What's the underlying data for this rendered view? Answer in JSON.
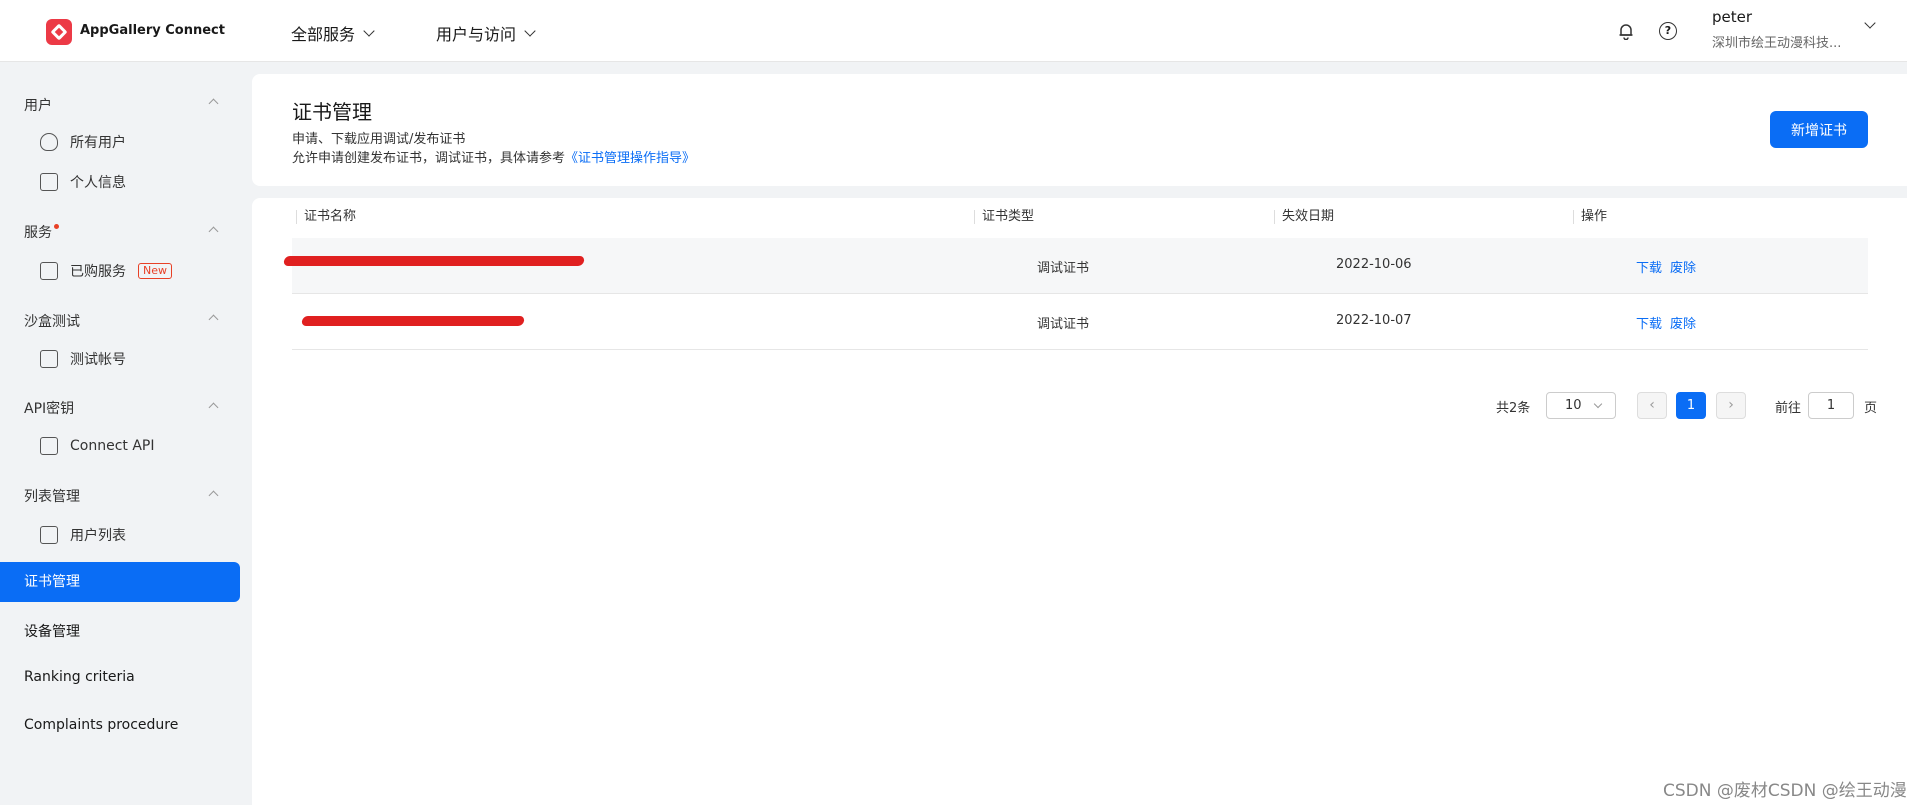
{
  "app": {
    "title": "AppGallery Connect"
  },
  "topnav": {
    "all_services": "全部服务",
    "user_access": "用户与访问"
  },
  "user": {
    "name": "peter",
    "org": "深圳市绘王动漫科技..."
  },
  "sidebar": {
    "section_user": "用户",
    "all_users": "所有用户",
    "profile": "个人信息",
    "section_service": "服务",
    "purchased": "已购服务",
    "new_badge": "New",
    "section_sandbox": "沙盒测试",
    "test_account": "测试帐号",
    "section_api": "API密钥",
    "connect_api": "Connect API",
    "section_list": "列表管理",
    "user_list": "用户列表",
    "cert_mgmt": "证书管理",
    "device_mgmt": "设备管理",
    "ranking": "Ranking criteria",
    "complaints": "Complaints procedure"
  },
  "header": {
    "title": "证书管理",
    "desc1": "申请、下载应用调试/发布证书",
    "desc2_prefix": "允许申请创建发布证书，调试证书，具体请参考",
    "desc2_link": "《证书管理操作指导》",
    "new_button": "新增证书"
  },
  "table": {
    "columns": [
      "证书名称",
      "证书类型",
      "失效日期",
      "操作"
    ],
    "rows": [
      {
        "type": "调试证书",
        "expire": "2022-10-06",
        "download": "下载",
        "revoke": "废除"
      },
      {
        "type": "调试证书",
        "expire": "2022-10-07",
        "download": "下载",
        "revoke": "废除"
      }
    ]
  },
  "pagination": {
    "total": "共2条",
    "page_size": "10",
    "current_page": "1",
    "goto_label": "前往",
    "goto_value": "1",
    "page_unit": "页"
  },
  "watermark": "CSDN @废材CSDN @绘王动漫"
}
